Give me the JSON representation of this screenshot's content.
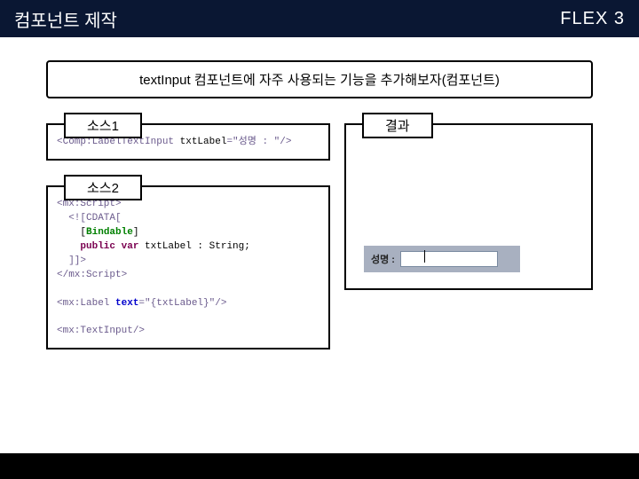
{
  "header": {
    "title": "컴포넌트 제작",
    "brand": "FLEX 3"
  },
  "subtitle": "textInput 컴포넌트에 자주 사용되는 기능을 추가해보자(컴포넌트)",
  "labels": {
    "src1": "소스1",
    "src2": "소스2",
    "result": "결과"
  },
  "src1": {
    "openTag": "<Comp:LabelTextInput ",
    "attr": "txtLabel",
    "val": "=\"성명 : \"/>"
  },
  "src2": {
    "l1": "<mx:Script>",
    "l2": "  <![CDATA[",
    "l3a": "    [",
    "l3b": "Bindable",
    "l3c": "]",
    "l4a": "    ",
    "l4b": "public var",
    "l4c": " txtLabel : String;",
    "l5": "  ]]>",
    "l6": "</mx:Script>",
    "l7a": "<mx:Label ",
    "l7b": "text",
    "l7c": "=\"{txtLabel}\"/>",
    "l8": "<mx:TextInput/>"
  },
  "demo": {
    "label": "성명 :"
  }
}
